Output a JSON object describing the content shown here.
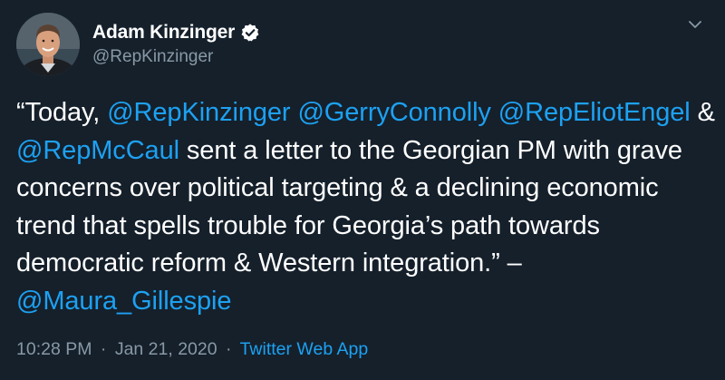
{
  "author": {
    "display_name": "Adam Kinzinger",
    "handle": "@RepKinzinger",
    "verified_icon": "verified-badge-icon",
    "avatar_icon": "profile-photo"
  },
  "menu": {
    "icon": "chevron-down-icon"
  },
  "tweet": {
    "segments": [
      {
        "type": "text",
        "value": "“Today, "
      },
      {
        "type": "mention",
        "value": "@RepKinzinger"
      },
      {
        "type": "text",
        "value": " "
      },
      {
        "type": "mention",
        "value": "@GerryConnolly"
      },
      {
        "type": "text",
        "value": " "
      },
      {
        "type": "mention",
        "value": "@RepEliotEngel"
      },
      {
        "type": "text",
        "value": " & "
      },
      {
        "type": "mention",
        "value": "@RepMcCaul"
      },
      {
        "type": "text",
        "value": " sent a letter to the Georgian PM with grave concerns over political targeting & a declining economic trend that spells trouble for Georgia’s path towards democratic reform & Western integration.” – "
      },
      {
        "type": "mention",
        "value": "@Maura_Gillespie"
      }
    ]
  },
  "meta": {
    "time": "10:28 PM",
    "separator1": "·",
    "date": "Jan 21, 2020",
    "separator2": "·",
    "source": "Twitter Web App"
  },
  "colors": {
    "background": "#15202b",
    "text": "#ffffff",
    "link": "#1da1f2",
    "muted": "#8899a6"
  }
}
